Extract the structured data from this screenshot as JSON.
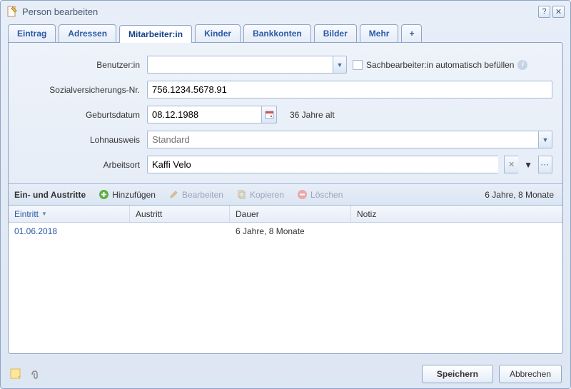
{
  "window": {
    "title": "Person bearbeiten"
  },
  "tabs": {
    "items": [
      {
        "label": "Eintrag"
      },
      {
        "label": "Adressen"
      },
      {
        "label": "Mitarbeiter:in"
      },
      {
        "label": "Kinder"
      },
      {
        "label": "Bankkonten"
      },
      {
        "label": "Bilder"
      },
      {
        "label": "Mehr"
      }
    ],
    "plus": "+"
  },
  "form": {
    "user": {
      "label": "Benutzer:in",
      "value": "",
      "auto_label": "Sachbearbeiter:in automatisch befüllen"
    },
    "ssn": {
      "label": "Sozialversicherungs-Nr.",
      "value": "756.1234.5678.91"
    },
    "dob": {
      "label": "Geburtsdatum",
      "value": "08.12.1988",
      "age": "36 Jahre alt"
    },
    "payslip": {
      "label": "Lohnausweis",
      "placeholder": "Standard"
    },
    "workplace": {
      "label": "Arbeitsort",
      "value": "Kaffi Velo"
    }
  },
  "grid": {
    "title": "Ein- und Austritte",
    "add": "Hinzufügen",
    "edit": "Bearbeiten",
    "copy": "Kopieren",
    "delete": "Löschen",
    "total": "6 Jahre, 8 Monate",
    "cols": {
      "c1": "Eintritt",
      "c2": "Austritt",
      "c3": "Dauer",
      "c4": "Notiz"
    },
    "rows": [
      {
        "c1": "01.06.2018",
        "c2": "",
        "c3": "6 Jahre, 8 Monate",
        "c4": ""
      }
    ]
  },
  "footer": {
    "save": "Speichern",
    "cancel": "Abbrechen"
  }
}
